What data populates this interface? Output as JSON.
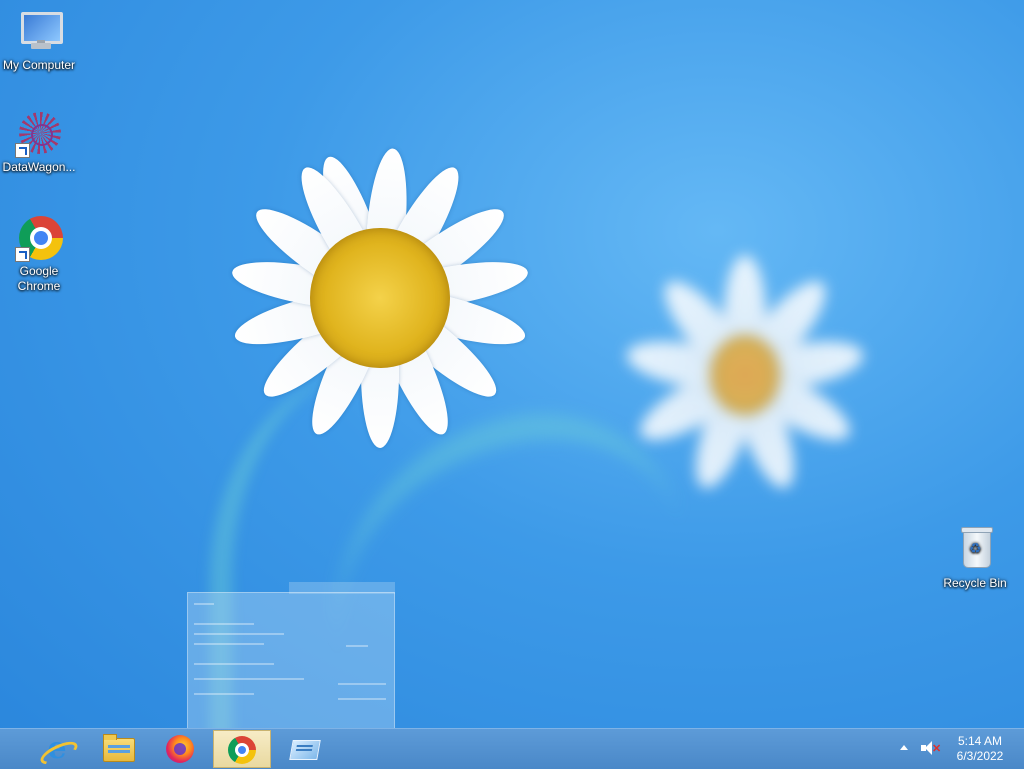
{
  "desktop": {
    "icons": [
      {
        "label": "My Computer",
        "icon": "computer-icon"
      },
      {
        "label": "DataWagon...",
        "icon": "datawagon-icon"
      },
      {
        "label": "Google Chrome",
        "icon": "chrome-icon"
      },
      {
        "label": "Recycle Bin",
        "icon": "recycle-bin-icon"
      }
    ]
  },
  "taskbar": {
    "buttons": [
      {
        "app": "internet-explorer",
        "icon": "internet-explorer-icon",
        "active": false
      },
      {
        "app": "file-explorer",
        "icon": "folder-icon",
        "active": false
      },
      {
        "app": "firefox",
        "icon": "firefox-icon",
        "active": false
      },
      {
        "app": "google-chrome",
        "icon": "chrome-icon",
        "active": true
      },
      {
        "app": "switch-windows",
        "icon": "switch-windows-icon",
        "active": false
      }
    ],
    "tray": {
      "overflow_icon": "show-hidden-icons-arrow",
      "volume_icon": "volume-muted-icon",
      "time": "5:14 AM",
      "date": "6/3/2022"
    }
  },
  "colors": {
    "taskbar": "#4a88c8",
    "active_button": "#f1e3b0",
    "wallpaper": "#3d9ae8"
  }
}
